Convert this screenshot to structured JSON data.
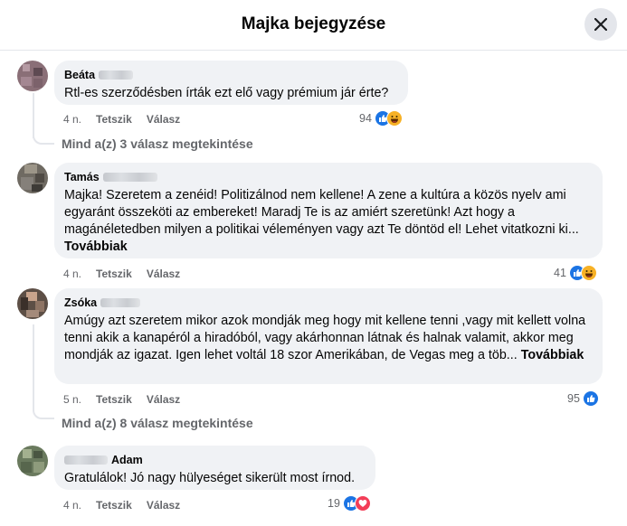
{
  "header": {
    "title": "Majka bejegyzése",
    "close_icon": "close-icon"
  },
  "comments": [
    {
      "author": "Beáta",
      "author_suffix": "",
      "text": "Rtl-es szerződésben írták ezt elő vagy prémium jár érte?",
      "more": "",
      "time": "4 n.",
      "like_label": "Tetszik",
      "reply_label": "Válasz",
      "reaction_count": "94",
      "reactions": [
        "like-icon",
        "haha-icon"
      ],
      "view_replies": "Mind a(z) 3 válasz megtekintése"
    },
    {
      "author": "Tamás",
      "author_suffix": "",
      "text": "Majka! Szeretem a zenéid! Politizálnod nem kellene! A zene a kultúra a közös nyelv ami egyaránt összeköti az embereket! Maradj Te is az amiért szeretünk! Azt hogy a magánéletedben milyen a politikai véleményen vagy azt Te döntöd el! Lehet vitatkozni ki...",
      "more": "Továbbiak",
      "time": "4 n.",
      "like_label": "Tetszik",
      "reply_label": "Válasz",
      "reaction_count": "41",
      "reactions": [
        "like-icon",
        "haha-icon"
      ],
      "view_replies": ""
    },
    {
      "author": "Zsóka",
      "author_suffix": "",
      "text": "Amúgy azt szeretem mikor azok mondják meg hogy mit kellene tenni ,vagy mit kellett volna tenni akik a kanapéról a hiradóból, vagy akárhonnan látnak és halnak valamit, akkor meg mondják az igazat. Igen lehet voltál 18 szor Amerikában, de Vegas meg a töb...",
      "more": "Továbbiak",
      "time": "5 n.",
      "like_label": "Tetszik",
      "reply_label": "Válasz",
      "reaction_count": "95",
      "reactions": [
        "like-icon"
      ],
      "view_replies": "Mind a(z) 8 válasz megtekintése"
    },
    {
      "author": "",
      "author_suffix": "Adam",
      "text": "Gratulálok! Jó nagy hülyeséget sikerült most írnod.",
      "more": "",
      "time": "4 n.",
      "like_label": "Tetszik",
      "reply_label": "Válasz",
      "reaction_count": "19",
      "reactions": [
        "like-icon",
        "love-icon"
      ],
      "view_replies": ""
    }
  ],
  "colors": {
    "bubble": "#f0f2f5",
    "like": "#1b74e4",
    "haha": "#f7b125",
    "love": "#f33e58",
    "secondary_text": "#65676b"
  }
}
